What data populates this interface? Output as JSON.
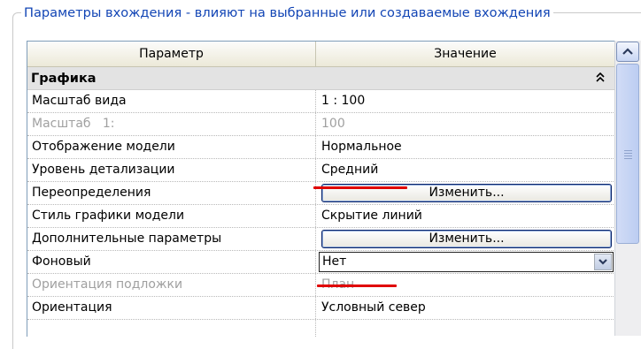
{
  "group": {
    "title": "Параметры вхождения - влияют на выбранные или создаваемые вхождения"
  },
  "table": {
    "col_param": "Параметр",
    "col_value": "Значение",
    "section_title": "Графика",
    "section_icon": "double-chevron-up-icon",
    "rows": [
      {
        "param": "Масштаб вида",
        "value": "1 : 100",
        "kind": "text",
        "disabled": false
      },
      {
        "param": "Масштаб   1:",
        "value": "100",
        "kind": "text",
        "disabled": true
      },
      {
        "param": "Отображение модели",
        "value": "Нормальное",
        "kind": "text",
        "disabled": false
      },
      {
        "param": "Уровень детализации",
        "value": "Средний",
        "kind": "text",
        "disabled": false,
        "underlined": true
      },
      {
        "param": "Переопределения",
        "value": "Изменить...",
        "kind": "button",
        "disabled": false
      },
      {
        "param": "Стиль графики модели",
        "value": "Скрытие линий",
        "kind": "text",
        "disabled": false
      },
      {
        "param": "Дополнительные параметры",
        "value": "Изменить...",
        "kind": "button",
        "disabled": false
      },
      {
        "param": "Фоновый",
        "value": "Нет",
        "kind": "select",
        "disabled": false,
        "underlined": true
      },
      {
        "param": "Ориентация подложки",
        "value": "План",
        "kind": "text",
        "disabled": true
      },
      {
        "param": "Ориентация",
        "value": "Условный север",
        "kind": "text",
        "disabled": false
      },
      {
        "param": "",
        "value": "",
        "kind": "text",
        "disabled": false
      }
    ]
  },
  "colors": {
    "title": "#1245b5",
    "annotation": "#e00000",
    "section_bg": "#e3e3e3",
    "disabled_text": "#a0a0a0"
  }
}
